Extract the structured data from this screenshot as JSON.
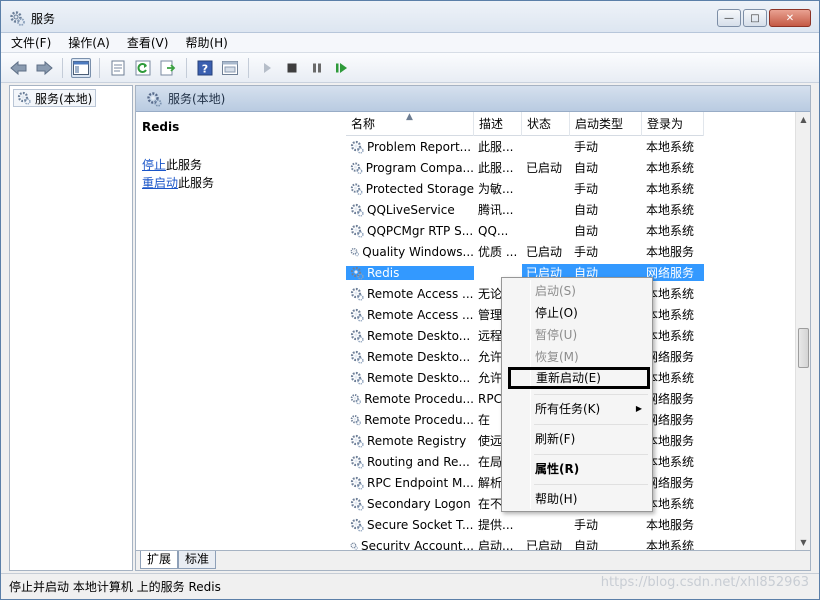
{
  "window": {
    "title": "服务",
    "min_label": "—",
    "max_label": "□",
    "close_label": "✕"
  },
  "menu": [
    "文件(F)",
    "操作(A)",
    "查看(V)",
    "帮助(H)"
  ],
  "tree": {
    "root": "服务(本地)"
  },
  "panel": {
    "header": "服务(本地)",
    "selected_service": "Redis",
    "stop_link": "停止",
    "stop_suffix": "此服务",
    "restart_link": "重启动",
    "restart_suffix": "此服务"
  },
  "columns": [
    "名称",
    "描述",
    "状态",
    "启动类型",
    "登录为"
  ],
  "rows": [
    {
      "name": "Problem Report...",
      "desc": "此服...",
      "status": "",
      "start": "手动",
      "logon": "本地系统"
    },
    {
      "name": "Program Compa...",
      "desc": "此服...",
      "status": "已启动",
      "start": "自动",
      "logon": "本地系统"
    },
    {
      "name": "Protected Storage",
      "desc": "为敏...",
      "status": "",
      "start": "手动",
      "logon": "本地系统"
    },
    {
      "name": "QQLiveService",
      "desc": "腾讯...",
      "status": "",
      "start": "自动",
      "logon": "本地系统"
    },
    {
      "name": "QQPCMgr RTP S...",
      "desc": "QQ...",
      "status": "",
      "start": "自动",
      "logon": "本地系统"
    },
    {
      "name": "Quality Windows...",
      "desc": "优质 ...",
      "status": "已启动",
      "start": "手动",
      "logon": "本地服务"
    },
    {
      "name": "Redis",
      "desc": "",
      "status": "已启动",
      "start": "自动",
      "logon": "网络服务"
    },
    {
      "name": "Remote Access ...",
      "desc": "无论",
      "status": "",
      "start": "",
      "logon": "本地系统"
    },
    {
      "name": "Remote Access ...",
      "desc": "管理",
      "status": "",
      "start": "",
      "logon": "本地系统"
    },
    {
      "name": "Remote Deskto...",
      "desc": "远程",
      "status": "",
      "start": "",
      "logon": "本地系统"
    },
    {
      "name": "Remote Deskto...",
      "desc": "允许",
      "status": "",
      "start": "",
      "logon": "网络服务"
    },
    {
      "name": "Remote Deskto...",
      "desc": "允许",
      "status": "",
      "start": "",
      "logon": "本地系统"
    },
    {
      "name": "Remote Procedu...",
      "desc": "RPC",
      "status": "",
      "start": "",
      "logon": "网络服务"
    },
    {
      "name": "Remote Procedu...",
      "desc": "在",
      "status": "",
      "start": "",
      "logon": "网络服务"
    },
    {
      "name": "Remote Registry",
      "desc": "使远",
      "status": "",
      "start": "",
      "logon": "本地服务"
    },
    {
      "name": "Routing and Re...",
      "desc": "在局",
      "status": "",
      "start": "",
      "logon": "本地系统"
    },
    {
      "name": "RPC Endpoint M...",
      "desc": "解析",
      "status": "",
      "start": "",
      "logon": "网络服务"
    },
    {
      "name": "Secondary Logon",
      "desc": "在不",
      "status": "",
      "start": "",
      "logon": "本地系统"
    },
    {
      "name": "Secure Socket T...",
      "desc": "提供...",
      "status": "",
      "start": "手动",
      "logon": "本地服务"
    },
    {
      "name": "Security Account...",
      "desc": "启动...",
      "status": "已启动",
      "start": "自动",
      "logon": "本地系统"
    }
  ],
  "context_menu": {
    "start": "启动(S)",
    "stop": "停止(O)",
    "pause": "暂停(U)",
    "resume": "恢复(M)",
    "restart": "重新启动(E)",
    "all_tasks": "所有任务(K)",
    "refresh": "刷新(F)",
    "properties": "属性(R)",
    "help": "帮助(H)"
  },
  "tabs": [
    "扩展",
    "标准"
  ],
  "status_text": "停止并启动 本地计算机 上的服务 Redis",
  "watermark": "https://blog.csdn.net/xhl852963",
  "colors": {
    "selection": "#3399ff",
    "link": "#1a55c8"
  }
}
